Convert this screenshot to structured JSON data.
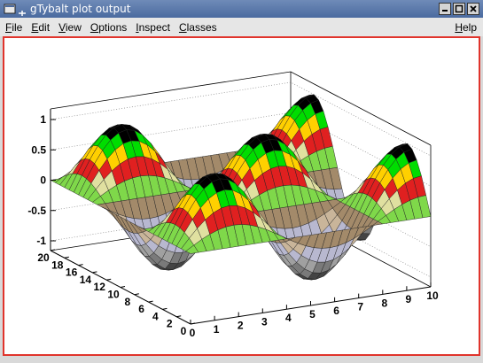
{
  "window": {
    "title": "gTybalt plot output"
  },
  "menubar": {
    "items": [
      {
        "name": "file",
        "label": "File",
        "underline": "F",
        "rest": "ile"
      },
      {
        "name": "edit",
        "label": "Edit",
        "underline": "E",
        "rest": "dit"
      },
      {
        "name": "view",
        "label": "View",
        "underline": "V",
        "rest": "iew"
      },
      {
        "name": "options",
        "label": "Options",
        "underline": "O",
        "rest": "ptions"
      },
      {
        "name": "inspect",
        "label": "Inspect",
        "underline": "I",
        "rest": "nspect"
      },
      {
        "name": "classes",
        "label": "Classes",
        "underline": "C",
        "rest": "lasses"
      }
    ],
    "help": {
      "label": "Help",
      "underline": "H",
      "rest": "elp"
    }
  },
  "colors": {
    "title_bar": "#4a6a9f",
    "canvas_border": "#e0342c",
    "canvas_bg": "#ffffff"
  },
  "chart_data": {
    "type": "surface",
    "function": "sin(x)*sin(y)",
    "z_ticks": [
      "1",
      "0.5",
      "0",
      "-0.5",
      "-1"
    ],
    "x_ticks": [
      "0",
      "1",
      "2",
      "3",
      "4",
      "5",
      "6",
      "7",
      "8",
      "9",
      "10"
    ],
    "y_ticks": [
      "0",
      "2",
      "4",
      "6",
      "8",
      "10",
      "12",
      "14",
      "16",
      "18",
      "20"
    ],
    "xlim": [
      0,
      10
    ],
    "ylim": [
      0,
      20
    ],
    "zlim": [
      -1,
      1
    ],
    "grid": true,
    "palette": [
      "#444444",
      "#7a7a7a",
      "#a0a0a0",
      "#b8b8d0",
      "#c9b59a",
      "#a38a6a",
      "#7fd84a",
      "#e0e0a0",
      "#e02020",
      "#ffd000",
      "#00dd00",
      "#000000"
    ]
  }
}
